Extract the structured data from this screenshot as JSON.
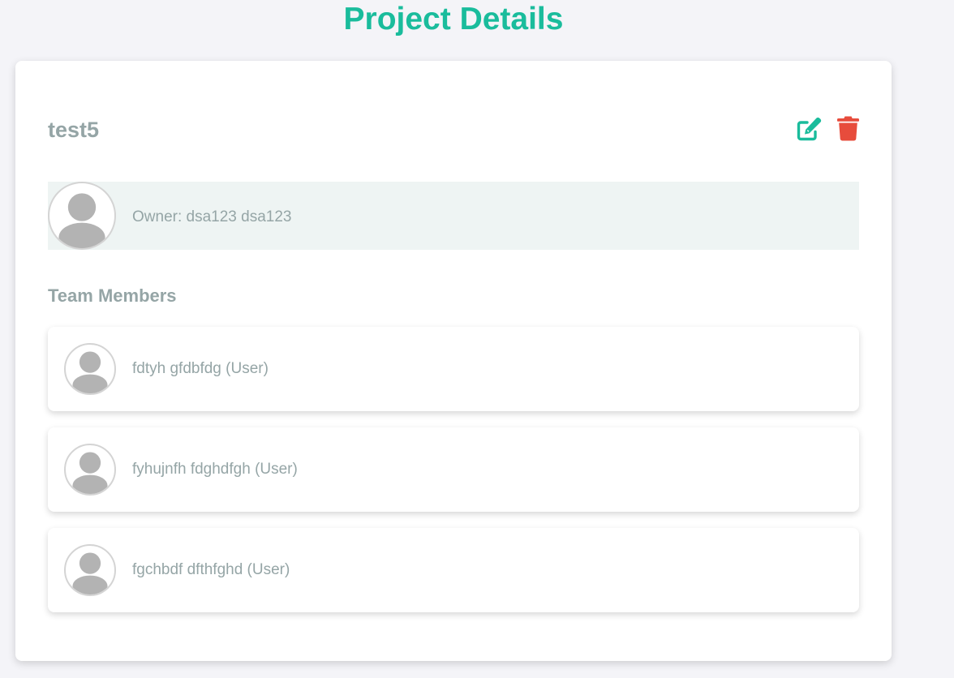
{
  "page": {
    "title": "Project Details"
  },
  "project": {
    "name": "test5",
    "actions": {
      "edit_icon": "edit-icon",
      "delete_icon": "trash-icon"
    },
    "owner": {
      "text": "Owner: dsa123 dsa123",
      "avatar_icon": "user-avatar-icon"
    }
  },
  "team": {
    "heading": "Team Members",
    "members": [
      {
        "label": "fdtyh gfdbfdg (User)"
      },
      {
        "label": "fyhujnfh fdghdfgh (User)"
      },
      {
        "label": "fgchbdf dfthfghd (User)"
      }
    ]
  },
  "colors": {
    "accent": "#1abc9c",
    "danger": "#e74c3c",
    "muted_text": "#95a5a6",
    "owner_background": "#eef4f3",
    "page_background": "#f4f4f8",
    "avatar_fill": "#b3b3b3"
  }
}
